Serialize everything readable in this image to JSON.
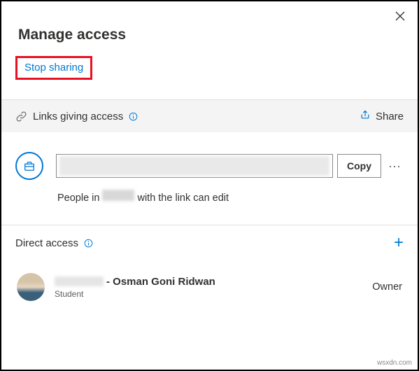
{
  "dialog": {
    "title": "Manage access",
    "stop_sharing_label": "Stop sharing"
  },
  "links_section": {
    "header_label": "Links giving access",
    "share_label": "Share",
    "copy_label": "Copy",
    "subtext_prefix": "People in",
    "subtext_suffix": "with the link can edit"
  },
  "direct_section": {
    "header_label": "Direct access"
  },
  "users": [
    {
      "name_suffix": "- Osman Goni Ridwan",
      "role": "Student",
      "permission": "Owner"
    }
  ],
  "watermark": "wsxdn.com"
}
